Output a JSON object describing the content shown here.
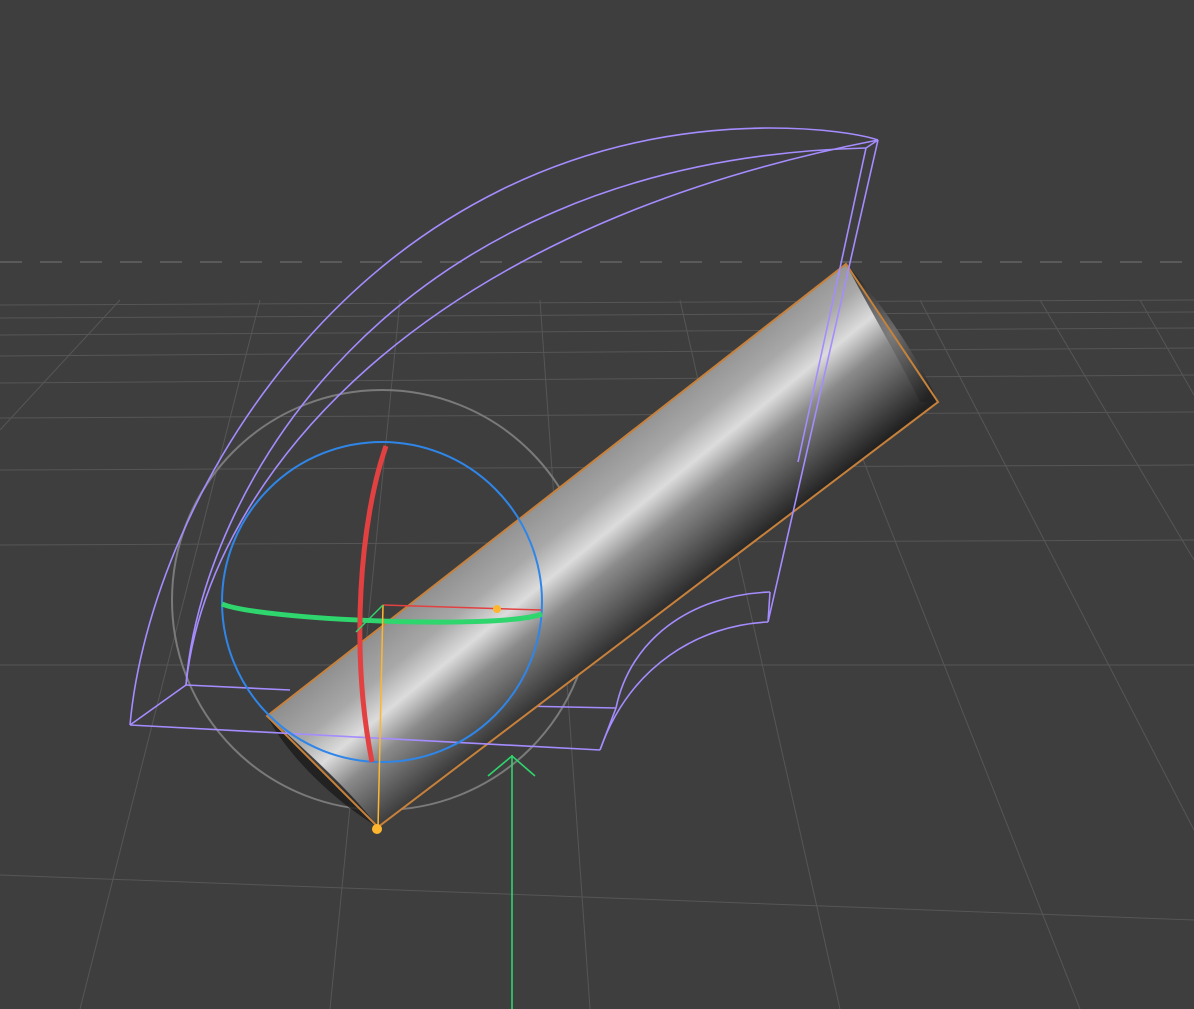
{
  "viewport": {
    "kind": "3d-perspective-viewport",
    "background_color": "#3e3e3e",
    "grid_color": "#565656",
    "horizon_color": "#5a5a5a"
  },
  "objects": {
    "bend_deformer_cage": {
      "kind": "bend-deformer-bounding-cage",
      "color": "#a58cff"
    },
    "cylinder": {
      "kind": "cylinder-mesh",
      "selected": true,
      "outline_color": "#c7813b"
    }
  },
  "gizmos": {
    "rotate_gizmo": {
      "kind": "rotation-manipulator",
      "x_ring_color": "#e34141",
      "y_ring_color": "#2fd56d",
      "z_ring_color": "#2f86e8",
      "outer_ring_color": "#7a7a7a"
    },
    "object_axis": {
      "x_color": "#e34141",
      "y_color": "#ffb62f",
      "handle_color": "#ffb62f"
    },
    "world_y_axis": {
      "color": "#2fd56d",
      "icon": "arrow-up-icon"
    }
  }
}
